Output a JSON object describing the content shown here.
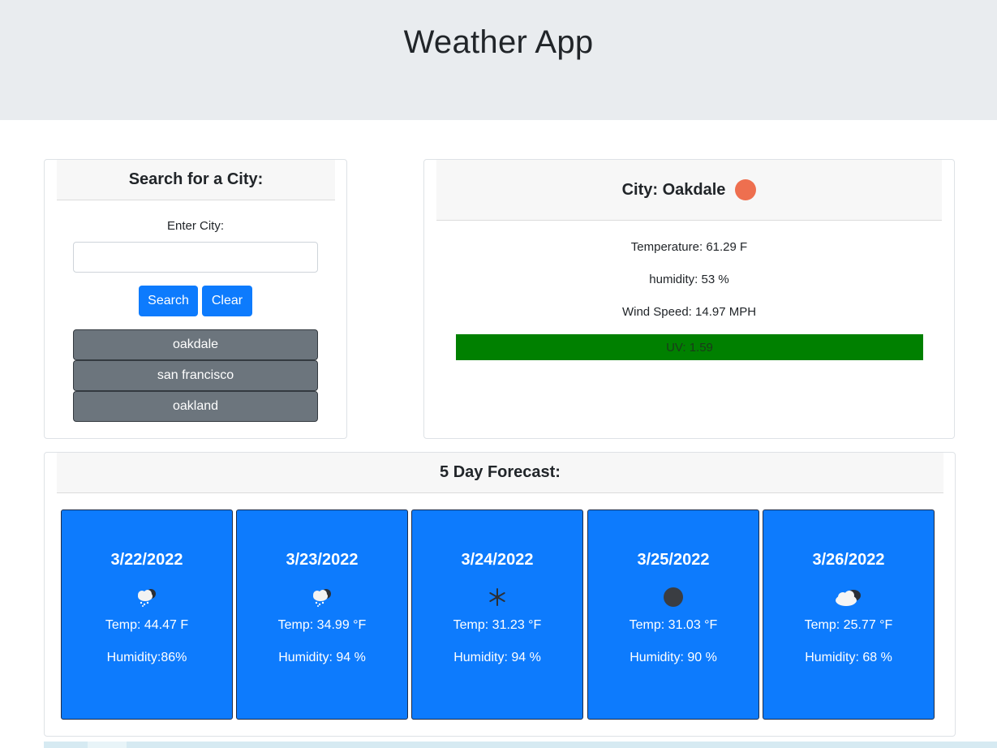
{
  "header": {
    "title": "Weather App"
  },
  "search": {
    "heading": "Search for a City:",
    "input_label": "Enter City:",
    "input_value": "",
    "input_placeholder": "",
    "search_label": "Search",
    "clear_label": "Clear",
    "history": [
      "oakdale",
      "san francisco",
      "oakland"
    ]
  },
  "current": {
    "city_title": "City: Oakdale",
    "icon": "sun-icon",
    "temperature": "Temperature: 61.29 F",
    "humidity": "humidity: 53 %",
    "wind": "Wind Speed: 14.97 MPH",
    "uv": "UV: 1.59",
    "uv_color": "#008000"
  },
  "forecast": {
    "heading": "5 Day Forecast:",
    "days": [
      {
        "date": "3/22/2022",
        "icon": "snow-cloud-icon",
        "temp": "Temp: 44.47 F",
        "humidity": "Humidity:86%"
      },
      {
        "date": "3/23/2022",
        "icon": "snow-cloud-icon",
        "temp": "Temp: 34.99 °F",
        "humidity": "Humidity: 94 %"
      },
      {
        "date": "3/24/2022",
        "icon": "snowflake-icon",
        "temp": "Temp: 31.23 °F",
        "humidity": "Humidity: 94 %"
      },
      {
        "date": "3/25/2022",
        "icon": "dark-circle-icon",
        "temp": "Temp: 31.03 °F",
        "humidity": "Humidity: 90 %"
      },
      {
        "date": "3/26/2022",
        "icon": "cloud-icon",
        "temp": "Temp: 25.77 °F",
        "humidity": "Humidity: 68 %"
      }
    ]
  },
  "colors": {
    "primary": "#0d7bfd",
    "secondary": "#6c757d",
    "header_bg": "#e9ecef"
  }
}
